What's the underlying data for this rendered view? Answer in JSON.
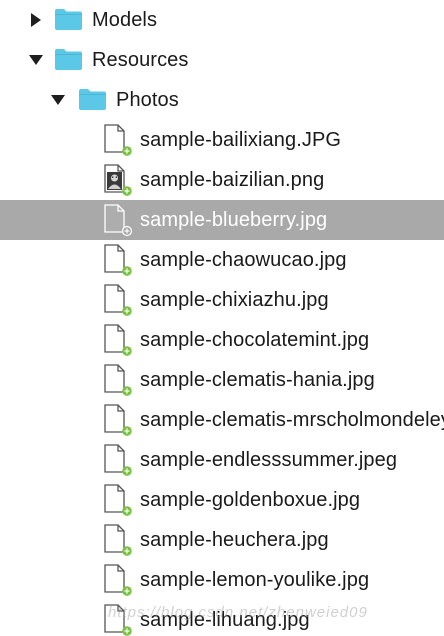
{
  "navigator": {
    "items": [
      {
        "label": "Models",
        "kind": "folder",
        "expanded": false,
        "level": 0
      },
      {
        "label": "Resources",
        "kind": "folder",
        "expanded": true,
        "level": 0
      },
      {
        "label": "Photos",
        "kind": "folder",
        "expanded": true,
        "level": 1
      },
      {
        "label": "sample-bailixiang.JPG",
        "kind": "file",
        "thumb": false,
        "status": "added",
        "selected": false
      },
      {
        "label": "sample-baizilian.png",
        "kind": "file",
        "thumb": true,
        "status": "added",
        "selected": false
      },
      {
        "label": "sample-blueberry.jpg",
        "kind": "file",
        "thumb": false,
        "status": "added",
        "selected": true
      },
      {
        "label": "sample-chaowucao.jpg",
        "kind": "file",
        "thumb": false,
        "status": "added",
        "selected": false
      },
      {
        "label": "sample-chixiazhu.jpg",
        "kind": "file",
        "thumb": false,
        "status": "added",
        "selected": false
      },
      {
        "label": "sample-chocolatemint.jpg",
        "kind": "file",
        "thumb": false,
        "status": "added",
        "selected": false
      },
      {
        "label": "sample-clematis-hania.jpg",
        "kind": "file",
        "thumb": false,
        "status": "added",
        "selected": false
      },
      {
        "label": "sample-clematis-mrscholmondeley.jpg",
        "kind": "file",
        "thumb": false,
        "status": "added",
        "selected": false
      },
      {
        "label": "sample-endlesssummer.jpeg",
        "kind": "file",
        "thumb": false,
        "status": "added",
        "selected": false
      },
      {
        "label": "sample-goldenboxue.jpg",
        "kind": "file",
        "thumb": false,
        "status": "added",
        "selected": false
      },
      {
        "label": "sample-heuchera.jpg",
        "kind": "file",
        "thumb": false,
        "status": "added",
        "selected": false
      },
      {
        "label": "sample-lemon-youlike.jpg",
        "kind": "file",
        "thumb": false,
        "status": "added",
        "selected": false
      },
      {
        "label": "sample-lihuang.jpg",
        "kind": "file",
        "thumb": false,
        "status": "added",
        "selected": false
      }
    ]
  },
  "colors": {
    "folder": "#5ac8e6",
    "selection": "#a9a9a9",
    "added_badge": "#7cc242",
    "text": "#1a1a1a",
    "disclosure": "#1e1e1e"
  },
  "watermark": "https://blog.csdn.net/zhenweied09"
}
